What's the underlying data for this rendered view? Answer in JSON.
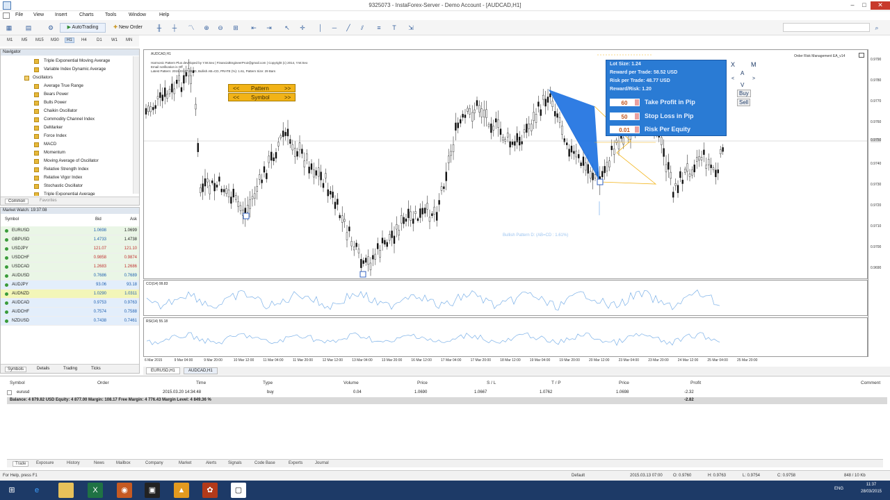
{
  "window": {
    "title": "9325073 - InstaForex-Server - Demo Account - [AUDCAD,H1]"
  },
  "menu": [
    "File",
    "View",
    "Insert",
    "Charts",
    "Tools",
    "Window",
    "Help"
  ],
  "toolbar": {
    "autotrading": "AutoTrading",
    "new_order": "New Order"
  },
  "timeframes": [
    "M1",
    "M5",
    "M15",
    "M30",
    "H1",
    "H4",
    "D1",
    "W1",
    "MN"
  ],
  "navigator": {
    "title": "Navigator",
    "items": [
      "Triple Exponential Moving Average",
      "Variable Index Dynamic Average",
      "Oscillators",
      "Average True Range",
      "Bears Power",
      "Bulls Power",
      "Chaikin Oscillator",
      "Commodity Channel Index",
      "DeMarker",
      "Force Index",
      "MACD",
      "Momentum",
      "Moving Average of Oscillator",
      "Relative Strength Index",
      "Relative Vigor Index",
      "Stochastic Oscillator",
      "Triple Exponential Average"
    ],
    "tabs": [
      "Common",
      "Favorites"
    ]
  },
  "market_watch": {
    "title": "Market Watch: 19:37:08",
    "columns": [
      "Symbol",
      "Bid",
      "Ask"
    ],
    "rows": [
      {
        "symbol": "EURUSD",
        "bid": "1.0698",
        "ask": "1.0699"
      },
      {
        "symbol": "GBPUSD",
        "bid": "1.4733",
        "ask": "1.4738"
      },
      {
        "symbol": "USDJPY",
        "bid": "121.07",
        "ask": "121.10"
      },
      {
        "symbol": "USDCHF",
        "bid": "0.9858",
        "ask": "0.9874"
      },
      {
        "symbol": "USDCAD",
        "bid": "1.2683",
        "ask": "1.2686"
      },
      {
        "symbol": "AUDUSD",
        "bid": "0.7686",
        "ask": "0.7689"
      },
      {
        "symbol": "AUDJPY",
        "bid": "93.06",
        "ask": "93.18"
      },
      {
        "symbol": "AUDNZD",
        "bid": "1.0290",
        "ask": "1.0311"
      },
      {
        "symbol": "AUDCAD",
        "bid": "0.9753",
        "ask": "0.9763"
      },
      {
        "symbol": "AUDCHF",
        "bid": "0.7574",
        "ask": "0.7588"
      },
      {
        "symbol": "NZDUSD",
        "bid": "0.7438",
        "ask": "0.7461"
      }
    ],
    "tabs": [
      "Symbols",
      "Details",
      "Trading",
      "Ticks"
    ]
  },
  "chart": {
    "symbol_label": "AUDCAD,H1",
    "info_lines": [
      "Harmonic Pattern Plus developed by Y.W.Seo | FinancialEngineerPro2@gmail.com | Copyright (c) 2014, Y.W.Seo",
      "Email notification is Off",
      "Latest Pattern: 2015.03.27 20:00, Bullish AB=CD, PRATE (%): 1.61, Pattern Size: 29 Bars"
    ],
    "ea_label": "Order Risk Management EA_v14",
    "pattern_label": "Bullish Pattern D: (AB=CD : 1.61%)",
    "pattern_btn": "Pattern",
    "symbol_btn": "Symbol",
    "arrows": [
      "<<",
      ">>"
    ],
    "panel": {
      "lot": "Lot Size: 1.24",
      "reward": "Reward per Trade: 58.52 USD",
      "risk": "Risk per Trade: 48.77 USD",
      "rr": "Reward/Risk: 1.20",
      "tp_value": "60",
      "tp_label": "Take Profit in Pip",
      "sl_value": "50",
      "sl_label": "Stop Loss in Pip",
      "re_value": "0.01",
      "re_label": "Risk Per Equity"
    },
    "side_buttons": {
      "x": "X",
      "m": "M",
      "a": "A",
      "v": "V",
      "buy": "Buy",
      "sell": "Sell"
    }
  },
  "indicator1": {
    "label": "CCI(14) 99.83"
  },
  "indicator2": {
    "label": "RSI(14) 55.18"
  },
  "price_axis": [
    "0.9790",
    "0.9780",
    "0.9770",
    "0.9760",
    "0.9750",
    "0.9740",
    "0.9730",
    "0.9720",
    "0.9710",
    "0.9700",
    "0.9690"
  ],
  "x_axis": [
    "6 Mar 2015",
    "9 Mar 04:00",
    "9 Mar 20:00",
    "10 Mar 12:00",
    "11 Mar 04:00",
    "11 Mar 20:00",
    "12 Mar 12:00",
    "13 Mar 04:00",
    "13 Mar 20:00",
    "16 Mar 12:00",
    "17 Mar 04:00",
    "17 Mar 20:00",
    "18 Mar 12:00",
    "19 Mar 04:00",
    "19 Mar 20:00",
    "20 Mar 12:00",
    "23 Mar 04:00",
    "23 Mar 20:00",
    "24 Mar 12:00",
    "25 Mar 04:00",
    "25 Mar 20:00"
  ],
  "chart_tabs": [
    "EURUSD,H1",
    "AUDCAD,H1"
  ],
  "terminal": {
    "columns": [
      "Symbol",
      "Order",
      "Time",
      "Type",
      "Volume",
      "Price",
      "S / L",
      "T / P",
      "Price",
      "Profit",
      "Comment"
    ],
    "trade_row": {
      "symbol": "eurusd",
      "time": "2015.03.20 14:34:48",
      "type": "buy",
      "volume": "0.04",
      "price": "1.0690",
      "sl": "1.0667",
      "tp": "1.0762",
      "price2": "1.0698",
      "profit": "-2.32"
    },
    "balance_line": "Balance: 4 879.82 USD  Equity: 4 877.00  Margin: 108.17  Free Margin: 4 776.43  Margin Level: 4 849.36 %",
    "balance_profit": "-2.82",
    "tabs": [
      "Trade",
      "Exposure",
      "History",
      "News",
      "Mailbox",
      "Company",
      "Market",
      "Alerts",
      "Signals",
      "Code Base",
      "Experts",
      "Journal"
    ]
  },
  "status": {
    "help": "For Help, press F1",
    "profile": "Default",
    "time": "2015.03.13 07:00",
    "open": "O: 0.9760",
    "high": "H: 0.9763",
    "low": "L: 0.9754",
    "close": "C: 0.9758",
    "traffic": "848 / 10 Kb"
  },
  "taskbar": {
    "lang": "ENG",
    "clock": "11:37",
    "date": "28/03/2015"
  }
}
